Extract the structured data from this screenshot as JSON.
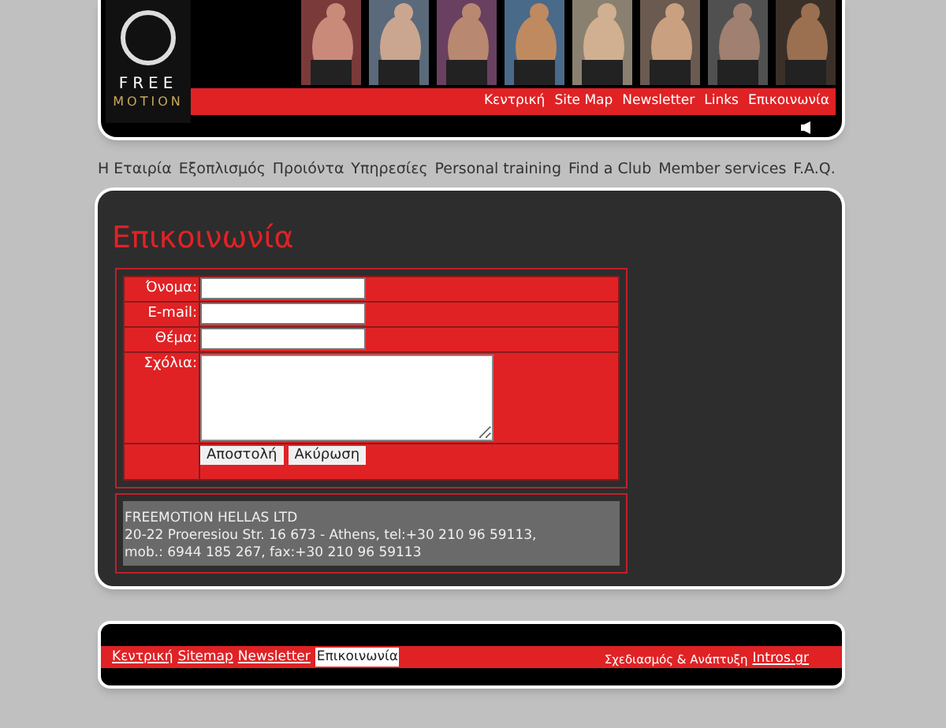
{
  "logo": {
    "line1": "FREE",
    "line2": "MOTION"
  },
  "header_links": [
    "Κεντρική",
    "Site Map",
    "Newsletter",
    "Links",
    "Επικοινωνία"
  ],
  "nav": [
    "Η Εταιρία",
    "Εξοπλισμός",
    "Προιόντα",
    "Υπηρεσίες",
    "Personal training",
    "Find a Club",
    "Member services",
    "F.A.Q."
  ],
  "page_title": "Επικοινωνία",
  "form": {
    "fields": [
      {
        "label": "Όνομα:",
        "kind": "text"
      },
      {
        "label": "E-mail:",
        "kind": "text"
      },
      {
        "label": "Θέμα:",
        "kind": "text"
      },
      {
        "label": "Σχόλια:",
        "kind": "textarea"
      }
    ],
    "buttons": [
      "Αποστολή",
      "Ακύρωση"
    ]
  },
  "contact": [
    "FREEMOTION HELLAS LTD",
    "20-22 Proeresiou Str. 16 673 - Athens, tel:+30 210 96 59113,",
    "mob.: 6944 185 267, fax:+30 210 96 59113"
  ],
  "footer": {
    "links": [
      {
        "label": "Κεντρική",
        "selected": false
      },
      {
        "label": "Sitemap",
        "selected": false
      },
      {
        "label": "Newsletter",
        "selected": false
      },
      {
        "label": "Επικοινωνία",
        "selected": true
      }
    ],
    "credit": "Σχεδιασμός & Ανάπτυξη",
    "credit_link": "Intros.gr"
  }
}
